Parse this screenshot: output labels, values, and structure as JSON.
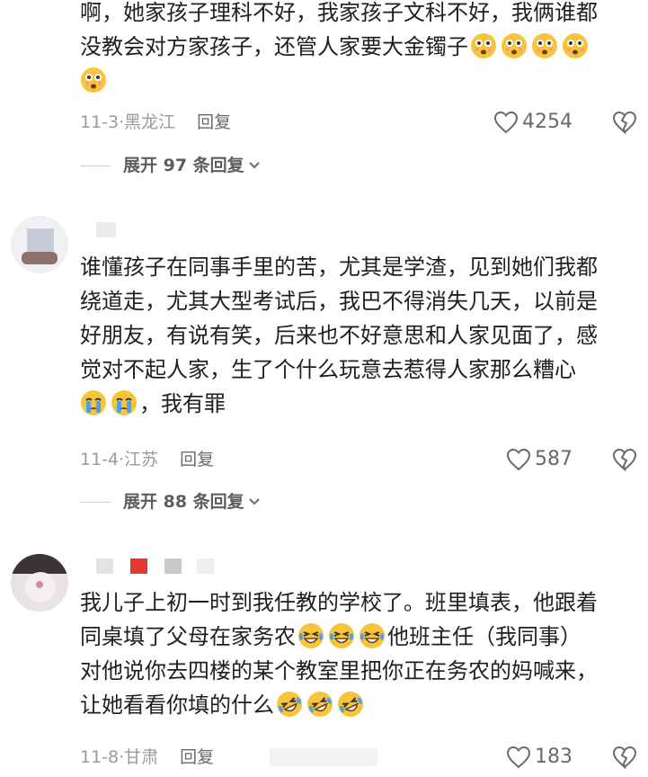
{
  "comments": [
    {
      "lines": [
        "啊，她家孩子理科不好，我家孩子文科不好，我俩谁都",
        "没教会对方家孩子，还管人家要大金镯子"
      ],
      "meta": "11-3·黑龙江",
      "reply_label": "回复",
      "likes": "4254",
      "expand": "展开 97 条回复",
      "emoji_set": "flushed-face-emoji"
    },
    {
      "lines": [
        "谁懂孩子在同事手里的苦，尤其是学渣，见到她们我都",
        "绕道走，尤其大型考试后，我巴不得消失几天，以前是",
        "好朋友，有说有笑，后来也不好意思和人家见面了，感",
        "觉对不起人家，生了个什么玩意去惹得人家那么糟心",
        "，我有罪"
      ],
      "meta": "11-4·江苏",
      "reply_label": "回复",
      "likes": "587",
      "expand": "展开 88 条回复",
      "emoji_set": "crying-face-emoji"
    },
    {
      "lines": [
        "我儿子上初一时到我任教的学校了。班里填表，他跟着",
        "同桌填了父母在家务农",
        "他班主任（我同事）",
        "对他说你去四楼的某个教室里把你正在务农的妈喊来，",
        "让她看看你填的什么"
      ],
      "meta": "11-8·甘肃",
      "reply_label": "回复",
      "likes": "183",
      "emoji_set": "laughing-crying-emoji"
    }
  ],
  "colors": {
    "text": "#1f1f1f",
    "meta": "#9a9a9a",
    "icon": "#6a6a6a",
    "emoji": "#f7c43a"
  }
}
